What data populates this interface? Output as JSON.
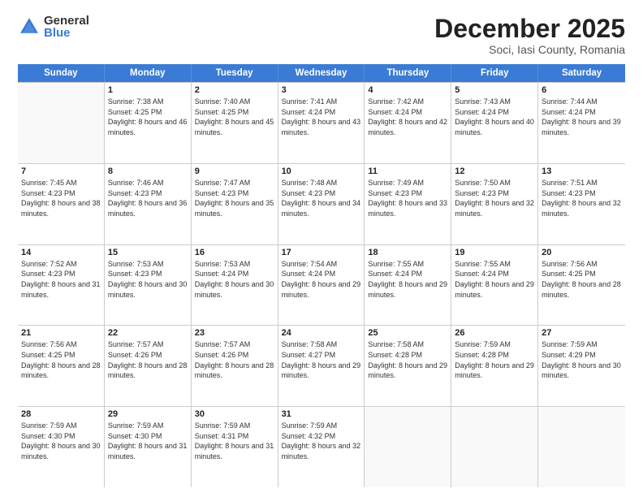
{
  "logo": {
    "general": "General",
    "blue": "Blue"
  },
  "title": "December 2025",
  "location": "Soci, Iasi County, Romania",
  "days": [
    "Sunday",
    "Monday",
    "Tuesday",
    "Wednesday",
    "Thursday",
    "Friday",
    "Saturday"
  ],
  "weeks": [
    [
      {
        "day": "",
        "sunrise": "",
        "sunset": "",
        "daylight": ""
      },
      {
        "day": "1",
        "sunrise": "Sunrise: 7:38 AM",
        "sunset": "Sunset: 4:25 PM",
        "daylight": "Daylight: 8 hours and 46 minutes."
      },
      {
        "day": "2",
        "sunrise": "Sunrise: 7:40 AM",
        "sunset": "Sunset: 4:25 PM",
        "daylight": "Daylight: 8 hours and 45 minutes."
      },
      {
        "day": "3",
        "sunrise": "Sunrise: 7:41 AM",
        "sunset": "Sunset: 4:24 PM",
        "daylight": "Daylight: 8 hours and 43 minutes."
      },
      {
        "day": "4",
        "sunrise": "Sunrise: 7:42 AM",
        "sunset": "Sunset: 4:24 PM",
        "daylight": "Daylight: 8 hours and 42 minutes."
      },
      {
        "day": "5",
        "sunrise": "Sunrise: 7:43 AM",
        "sunset": "Sunset: 4:24 PM",
        "daylight": "Daylight: 8 hours and 40 minutes."
      },
      {
        "day": "6",
        "sunrise": "Sunrise: 7:44 AM",
        "sunset": "Sunset: 4:24 PM",
        "daylight": "Daylight: 8 hours and 39 minutes."
      }
    ],
    [
      {
        "day": "7",
        "sunrise": "Sunrise: 7:45 AM",
        "sunset": "Sunset: 4:23 PM",
        "daylight": "Daylight: 8 hours and 38 minutes."
      },
      {
        "day": "8",
        "sunrise": "Sunrise: 7:46 AM",
        "sunset": "Sunset: 4:23 PM",
        "daylight": "Daylight: 8 hours and 36 minutes."
      },
      {
        "day": "9",
        "sunrise": "Sunrise: 7:47 AM",
        "sunset": "Sunset: 4:23 PM",
        "daylight": "Daylight: 8 hours and 35 minutes."
      },
      {
        "day": "10",
        "sunrise": "Sunrise: 7:48 AM",
        "sunset": "Sunset: 4:23 PM",
        "daylight": "Daylight: 8 hours and 34 minutes."
      },
      {
        "day": "11",
        "sunrise": "Sunrise: 7:49 AM",
        "sunset": "Sunset: 4:23 PM",
        "daylight": "Daylight: 8 hours and 33 minutes."
      },
      {
        "day": "12",
        "sunrise": "Sunrise: 7:50 AM",
        "sunset": "Sunset: 4:23 PM",
        "daylight": "Daylight: 8 hours and 32 minutes."
      },
      {
        "day": "13",
        "sunrise": "Sunrise: 7:51 AM",
        "sunset": "Sunset: 4:23 PM",
        "daylight": "Daylight: 8 hours and 32 minutes."
      }
    ],
    [
      {
        "day": "14",
        "sunrise": "Sunrise: 7:52 AM",
        "sunset": "Sunset: 4:23 PM",
        "daylight": "Daylight: 8 hours and 31 minutes."
      },
      {
        "day": "15",
        "sunrise": "Sunrise: 7:53 AM",
        "sunset": "Sunset: 4:23 PM",
        "daylight": "Daylight: 8 hours and 30 minutes."
      },
      {
        "day": "16",
        "sunrise": "Sunrise: 7:53 AM",
        "sunset": "Sunset: 4:24 PM",
        "daylight": "Daylight: 8 hours and 30 minutes."
      },
      {
        "day": "17",
        "sunrise": "Sunrise: 7:54 AM",
        "sunset": "Sunset: 4:24 PM",
        "daylight": "Daylight: 8 hours and 29 minutes."
      },
      {
        "day": "18",
        "sunrise": "Sunrise: 7:55 AM",
        "sunset": "Sunset: 4:24 PM",
        "daylight": "Daylight: 8 hours and 29 minutes."
      },
      {
        "day": "19",
        "sunrise": "Sunrise: 7:55 AM",
        "sunset": "Sunset: 4:24 PM",
        "daylight": "Daylight: 8 hours and 29 minutes."
      },
      {
        "day": "20",
        "sunrise": "Sunrise: 7:56 AM",
        "sunset": "Sunset: 4:25 PM",
        "daylight": "Daylight: 8 hours and 28 minutes."
      }
    ],
    [
      {
        "day": "21",
        "sunrise": "Sunrise: 7:56 AM",
        "sunset": "Sunset: 4:25 PM",
        "daylight": "Daylight: 8 hours and 28 minutes."
      },
      {
        "day": "22",
        "sunrise": "Sunrise: 7:57 AM",
        "sunset": "Sunset: 4:26 PM",
        "daylight": "Daylight: 8 hours and 28 minutes."
      },
      {
        "day": "23",
        "sunrise": "Sunrise: 7:57 AM",
        "sunset": "Sunset: 4:26 PM",
        "daylight": "Daylight: 8 hours and 28 minutes."
      },
      {
        "day": "24",
        "sunrise": "Sunrise: 7:58 AM",
        "sunset": "Sunset: 4:27 PM",
        "daylight": "Daylight: 8 hours and 29 minutes."
      },
      {
        "day": "25",
        "sunrise": "Sunrise: 7:58 AM",
        "sunset": "Sunset: 4:28 PM",
        "daylight": "Daylight: 8 hours and 29 minutes."
      },
      {
        "day": "26",
        "sunrise": "Sunrise: 7:59 AM",
        "sunset": "Sunset: 4:28 PM",
        "daylight": "Daylight: 8 hours and 29 minutes."
      },
      {
        "day": "27",
        "sunrise": "Sunrise: 7:59 AM",
        "sunset": "Sunset: 4:29 PM",
        "daylight": "Daylight: 8 hours and 30 minutes."
      }
    ],
    [
      {
        "day": "28",
        "sunrise": "Sunrise: 7:59 AM",
        "sunset": "Sunset: 4:30 PM",
        "daylight": "Daylight: 8 hours and 30 minutes."
      },
      {
        "day": "29",
        "sunrise": "Sunrise: 7:59 AM",
        "sunset": "Sunset: 4:30 PM",
        "daylight": "Daylight: 8 hours and 31 minutes."
      },
      {
        "day": "30",
        "sunrise": "Sunrise: 7:59 AM",
        "sunset": "Sunset: 4:31 PM",
        "daylight": "Daylight: 8 hours and 31 minutes."
      },
      {
        "day": "31",
        "sunrise": "Sunrise: 7:59 AM",
        "sunset": "Sunset: 4:32 PM",
        "daylight": "Daylight: 8 hours and 32 minutes."
      },
      {
        "day": "",
        "sunrise": "",
        "sunset": "",
        "daylight": ""
      },
      {
        "day": "",
        "sunrise": "",
        "sunset": "",
        "daylight": ""
      },
      {
        "day": "",
        "sunrise": "",
        "sunset": "",
        "daylight": ""
      }
    ]
  ]
}
